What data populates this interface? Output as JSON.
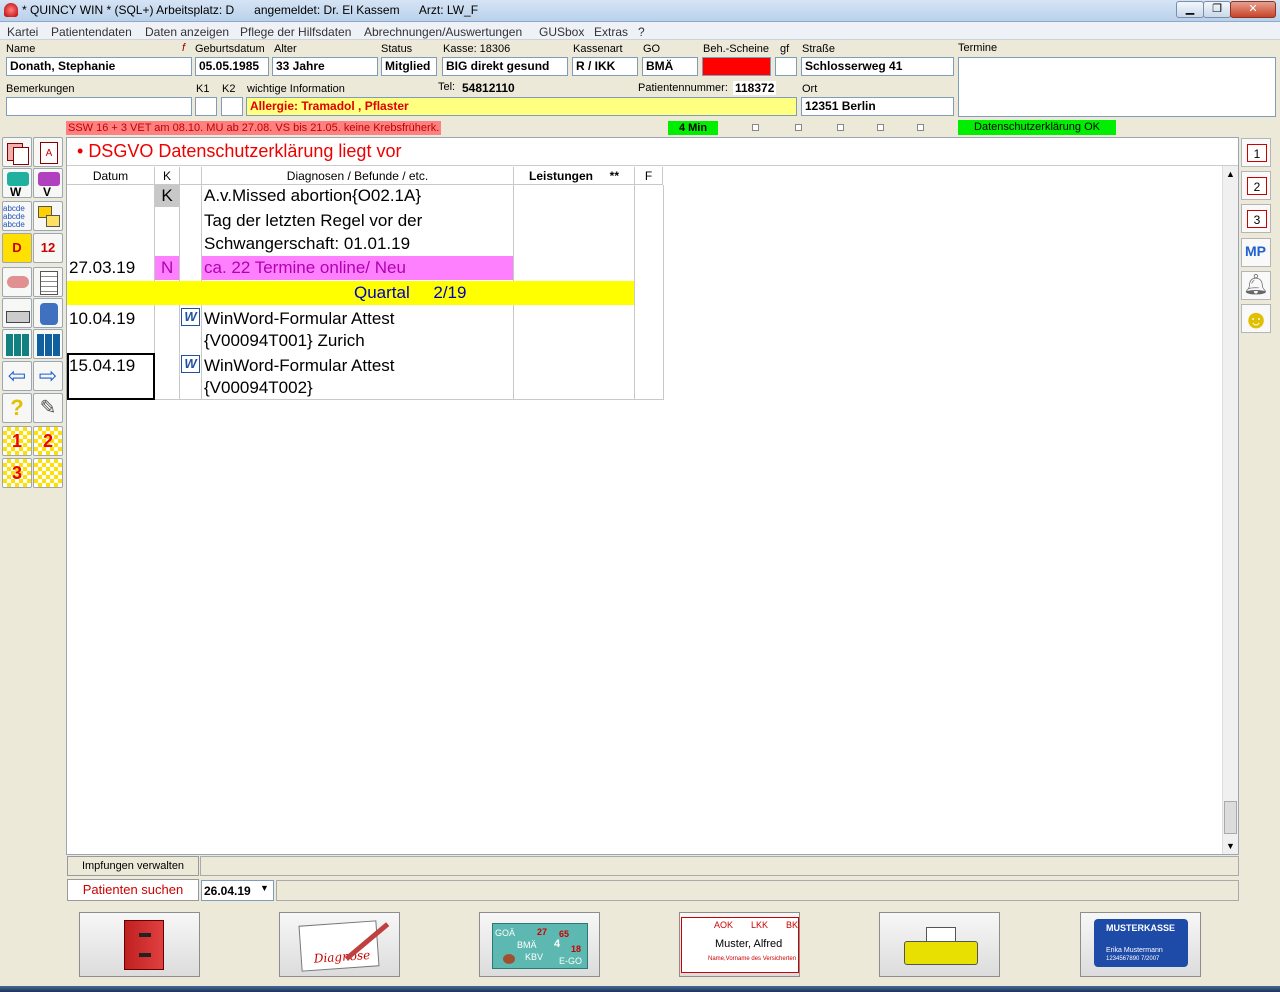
{
  "window": {
    "title": "* QUINCY WIN * (SQL+) Arbeitsplatz: D      angemeldet: Dr. El Kassem      Arzt: LW_F"
  },
  "menu": [
    "Kartei",
    "Patientendaten",
    "Daten anzeigen",
    "Pflege der Hilfsdaten",
    "Abrechnungen/Auswertungen",
    "GUSbox",
    "Extras",
    "?"
  ],
  "header": {
    "labels": {
      "name": "Name",
      "f": "f",
      "geburtsdatum": "Geburtsdatum",
      "alter": "Alter",
      "status": "Status",
      "kasse": "Kasse: 18306",
      "kassenart": "Kassenart",
      "go": "GO",
      "behscheine": "Beh.-Scheine",
      "gf": "gf",
      "strasse": "Straße",
      "termine": "Termine",
      "bemerkungen": "Bemerkungen",
      "k1": "K1",
      "k2": "K2",
      "wichtig": "wichtige Information",
      "tel": "Tel:",
      "patientennummer": "Patientennummer:",
      "ort": "Ort"
    },
    "values": {
      "name": "Donath, Stephanie",
      "geburtsdatum": "05.05.1985",
      "alter": "33 Jahre",
      "status": "Mitglied",
      "kasse": "BIG direkt gesund",
      "kassenart": "R / IKK",
      "go": "BMÄ",
      "strasse": "Schlosserweg 41",
      "bemerkungen": "",
      "wichtig": "Allergie: Tramadol ,  Pflaster",
      "tel": "54812110",
      "patientennummer": "118372",
      "ort": "12351 Berlin"
    }
  },
  "strip": {
    "info": "SSW 16 + 3  VET  am 08.10.  MU ab 27.08.  VS bis 21.05.  keine Krebsfrüherk.",
    "timer": "4 Min",
    "dsgvo": "Datenschutzerklärung OK"
  },
  "banner": "DSGVO Datenschutzerklärung liegt vor",
  "table": {
    "headers": {
      "datum": "Datum",
      "k": "K",
      "diagnosen": "Diagnosen / Befunde / etc.",
      "leistungen": "Leistungen",
      "stars": "**",
      "f": "F"
    },
    "rows": [
      {
        "datum": "",
        "k": "K",
        "text1": "A.v.Missed abortion{O02.1A}",
        "text2": "Tag der letzten Regel vor der",
        "text3": "Schwangerschaft: 01.01.19"
      },
      {
        "datum": "27.03.19",
        "k": "N",
        "text1": "ca. 22 Termine online/ Neu"
      },
      {
        "quartal": "Quartal     2/19"
      },
      {
        "datum": "10.04.19",
        "k": "",
        "text1": "WinWord-Formular Attest",
        "text2": "{V00094T001} Zurich"
      },
      {
        "datum": "15.04.19",
        "k": "",
        "text1": "WinWord-Formular Attest",
        "text2": "{V00094T002}"
      }
    ]
  },
  "bottom": {
    "impfungen": "Impfungen verwalten",
    "suchen": "Patienten suchen",
    "date": "26.04.19"
  },
  "toolbar": {
    "diagnose_label": "Diagnose",
    "goa": {
      "goa": "GOÄ",
      "bma": "BMÄ",
      "kbv": "KBV",
      "n1": "27",
      "n2": "65",
      "n3": "4",
      "n4": "18",
      "ego": "E-GO"
    },
    "card": {
      "aok": "AOK",
      "lkk": "LKK",
      "bk": "BK",
      "name": "Muster, Alfred",
      "sub": "Name,Vorname des Versicherten"
    },
    "muster": {
      "title": "MUSTERKASSE",
      "name": "Erika Mustermann",
      "num": "1234567890  7/2007"
    }
  },
  "right_icons": [
    "1",
    "2",
    "3",
    "MP"
  ],
  "colors": {
    "pink": "#ff80ff",
    "yellow": "#ffff00",
    "red": "#ff0000",
    "green": "#00ee00",
    "banner_red": "#ee0000"
  }
}
